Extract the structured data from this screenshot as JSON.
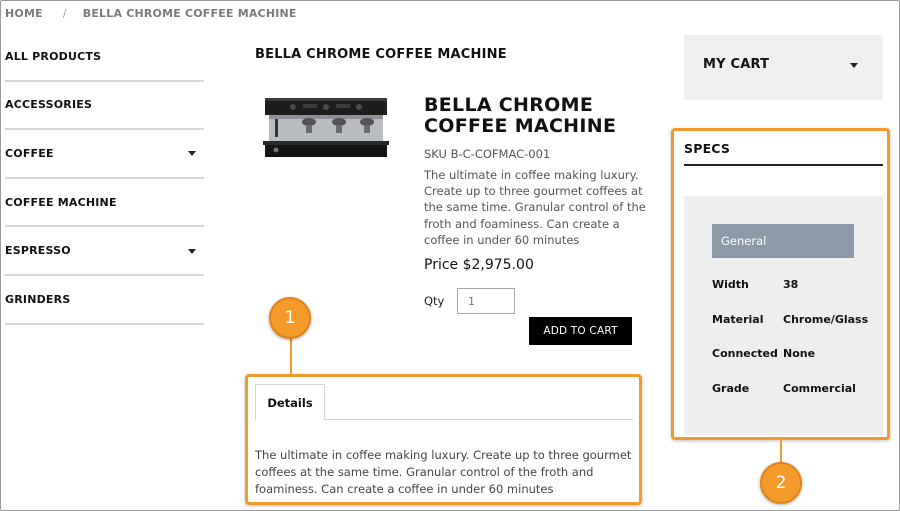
{
  "breadcrumb": {
    "home": "HOME",
    "separator": "/",
    "current": "BELLA CHROME COFFEE MACHINE"
  },
  "sidebar": {
    "items": [
      {
        "label": "ALL PRODUCTS",
        "has_submenu": false
      },
      {
        "label": "ACCESSORIES",
        "has_submenu": false
      },
      {
        "label": "COFFEE",
        "has_submenu": true
      },
      {
        "label": "COFFEE MACHINE",
        "has_submenu": false
      },
      {
        "label": "ESPRESSO",
        "has_submenu": true
      },
      {
        "label": "GRINDERS",
        "has_submenu": false
      }
    ]
  },
  "product": {
    "page_title": "BELLA CHROME COFFEE MACHINE",
    "name": "BELLA CHROME COFFEE MACHINE",
    "sku": "SKU B-C-COFMAC-001",
    "description": "The ultimate in coffee making luxury. Create up to three gourmet coffees at the same time. Granular control of the froth and foaminess. Can create a coffee in under 60 minutes",
    "price": "Price $2,975.00",
    "qty_label": "Qty",
    "qty_value": "1",
    "add_to_cart_label": "ADD TO CART"
  },
  "tabs": {
    "details_label": "Details",
    "details_text": "The ultimate in coffee making luxury. Create up to three gourmet coffees at the same time. Granular control of the froth and foaminess. Can create a coffee in under 60 minutes"
  },
  "cart": {
    "label": "MY CART"
  },
  "specs": {
    "title": "SPECS",
    "group_label": "General",
    "rows": [
      {
        "key": "Width",
        "value": "38"
      },
      {
        "key": "Material",
        "value": "Chrome/Glass"
      },
      {
        "key": "Connected",
        "value": "None"
      },
      {
        "key": "Grade",
        "value": "Commercial"
      }
    ]
  },
  "callouts": {
    "one": "1",
    "two": "2"
  },
  "colors": {
    "callout": "#f39a2b",
    "general_tab": "#8c9aa8",
    "button": "#000000",
    "panel": "#eeeeee"
  },
  "icons": {
    "submenu": "chevron-down-icon",
    "cart": "chevron-down-icon"
  }
}
